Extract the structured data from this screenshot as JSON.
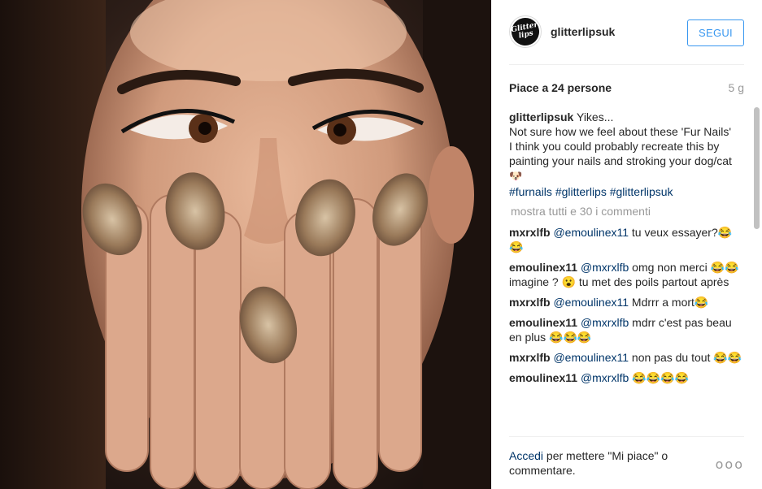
{
  "post": {
    "username": "glitterlipsuk",
    "avatar_text": "Glitter lips",
    "follow_label": "SEGUI",
    "likes": "Piace a 24 persone",
    "age": "5 g"
  },
  "caption": {
    "username": "glitterlipsuk",
    "line1": "Yikes...",
    "line2": "Not sure how we feel about these 'Fur Nails'",
    "line3": "I think you could probably recreate this by painting your nails and stroking your dog/cat",
    "dog_emoji": "🐶",
    "tags": [
      "#furnails",
      "#glitterlips",
      "#glitterlipsuk"
    ]
  },
  "load_more": "mostra tutti e 30 i commenti",
  "comments": [
    {
      "user": "mxrxlfb",
      "mention": "@emoulinex11",
      "text": "tu veux essayer?😂😂"
    },
    {
      "user": "emoulinex11",
      "mention": "@mxrxlfb",
      "text": "omg non merci 😂😂 imagine ? 😮 tu met des poils partout après"
    },
    {
      "user": "mxrxlfb",
      "mention": "@emoulinex11",
      "text": "Mdrrr a mort😂"
    },
    {
      "user": "emoulinex11",
      "mention": "@mxrxlfb",
      "text": "mdrr c'est pas beau en plus 😂😂😂"
    },
    {
      "user": "mxrxlfb",
      "mention": "@emoulinex11",
      "text": "non pas du tout 😂😂"
    },
    {
      "user": "emoulinex11",
      "mention": "@mxrxlfb",
      "text": "😂😂😂😂"
    }
  ],
  "footer": {
    "login_link": "Accedi",
    "login_rest": "per mettere \"Mi piace\" o commentare.",
    "more_label": "ooo"
  },
  "colors": {
    "link": "#003569",
    "accent": "#3897f0",
    "muted": "#999999"
  }
}
